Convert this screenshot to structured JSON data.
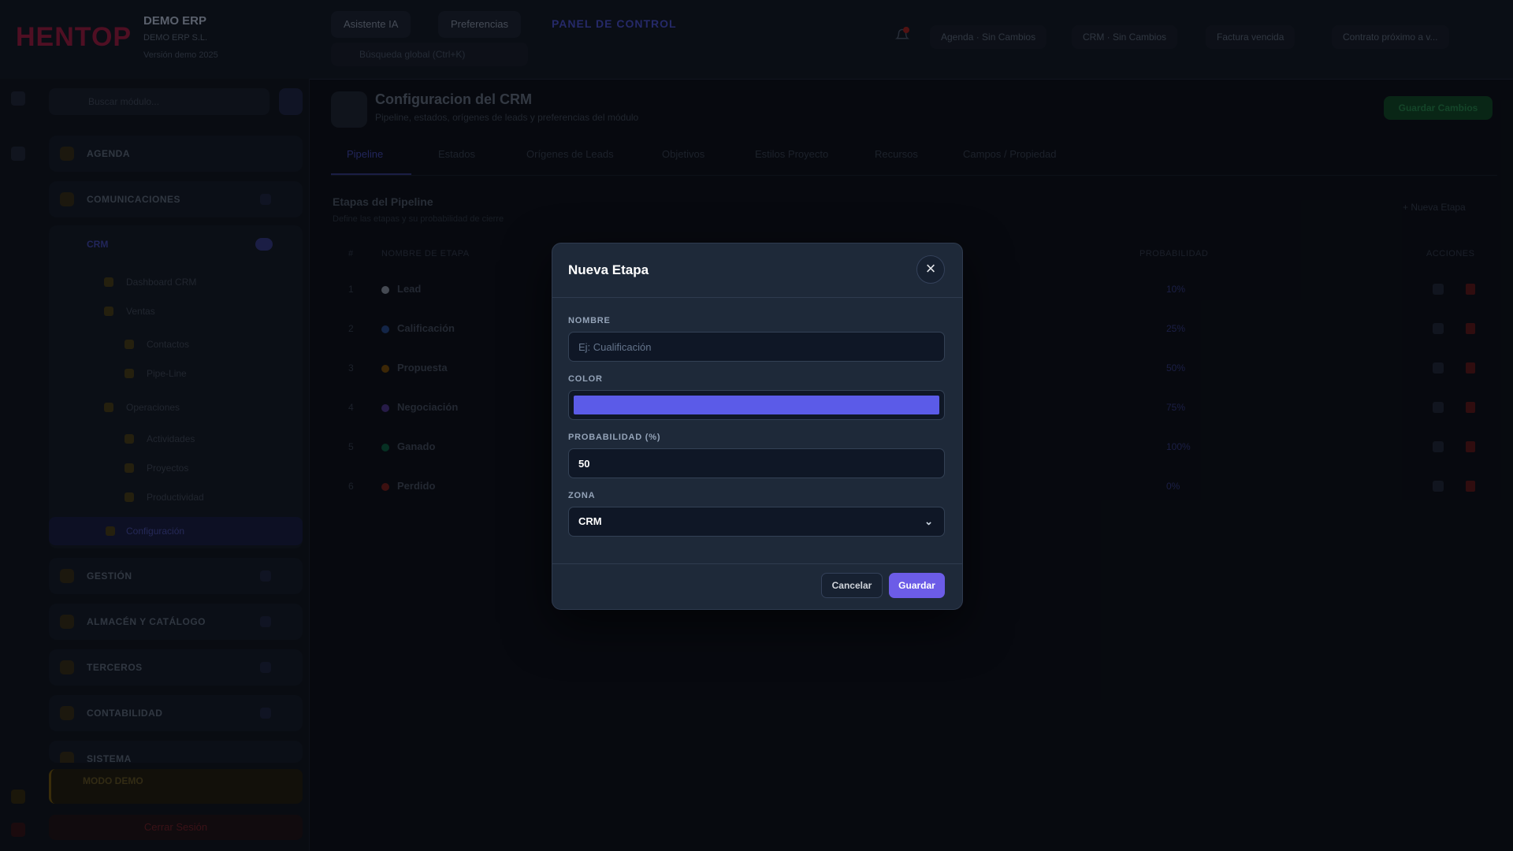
{
  "app": {
    "logo": "HENTOP",
    "company_name": "DEMO ERP",
    "company_sub": "DEMO ERP S.L.",
    "company_meta": "Versión demo 2025",
    "top_tabs": [
      "Asistente IA",
      "Preferencias"
    ],
    "top_link": "PANEL DE CONTROL",
    "search_placeholder": "Búsqueda global (Ctrl+K)",
    "top_pills": [
      "Agenda · Sin Cambios",
      "CRM · Sin Cambios",
      "Factura vencida",
      "Contrato próximo a v..."
    ]
  },
  "sidebar": {
    "search_placeholder": "Buscar módulo...",
    "sections": [
      "AGENDA",
      "COMUNICACIONES",
      "GESTIÓN",
      "ALMACÉN Y CATÁLOGO",
      "TERCEROS",
      "CONTABILIDAD",
      "SISTEMA"
    ],
    "crm_label": "CRM",
    "crm_items": [
      "Dashboard CRM",
      "Ventas",
      "Contactos",
      "Pipe-Line",
      "Operaciones",
      "Actividades",
      "Proyectos",
      "Productividad",
      "Configuración"
    ],
    "demo_mode": "MODO DEMO",
    "logout": "Cerrar Sesión"
  },
  "main": {
    "title": "Configuracion del CRM",
    "subtitle": "Pipeline, estados, orígenes de leads y preferencias del módulo",
    "save_button": "Guardar Cambios",
    "tabs": [
      "Pipeline",
      "Estados",
      "Orígenes de Leads",
      "Objetivos",
      "Estilos Proyecto",
      "Recursos",
      "Campos / Propiedad"
    ],
    "section_title": "Etapas del Pipeline",
    "section_subtitle": "Define las etapas y su probabilidad de cierre",
    "new_stage_link": "+ Nueva Etapa",
    "columns": [
      "#",
      "NOMBRE DE ETAPA",
      "PROBABILIDAD",
      "ACCIONES"
    ],
    "stages": [
      {
        "num": "1",
        "name": "Lead",
        "prob": "10%",
        "color": "#6b7280"
      },
      {
        "num": "2",
        "name": "Calificación",
        "prob": "25%",
        "color": "#3b82f6"
      },
      {
        "num": "3",
        "name": "Propuesta",
        "prob": "50%",
        "color": "#f59e0b"
      },
      {
        "num": "4",
        "name": "Negociación",
        "prob": "75%",
        "color": "#8b5cf6"
      },
      {
        "num": "5",
        "name": "Ganado",
        "prob": "100%",
        "color": "#10b981"
      },
      {
        "num": "6",
        "name": "Perdido",
        "prob": "0%",
        "color": "#ef4444"
      }
    ]
  },
  "modal": {
    "title": "Nueva Etapa",
    "close_icon": "close-icon",
    "name_label": "NOMBRE",
    "name_placeholder": "Ej: Cualificación",
    "name_value": "",
    "color_label": "COLOR",
    "color_value": "#5b5be8",
    "probability_label": "PROBABILIDAD (%)",
    "probability_value": "50",
    "zone_label": "ZONA",
    "zone_value": "CRM",
    "zone_arrow": "⌄",
    "cancel_label": "Cancelar",
    "save_label": "Guardar"
  },
  "colors": {
    "accent": "#6c5ce7",
    "modal_bg": "#1e2939",
    "page_bg": "#0b0f17"
  }
}
